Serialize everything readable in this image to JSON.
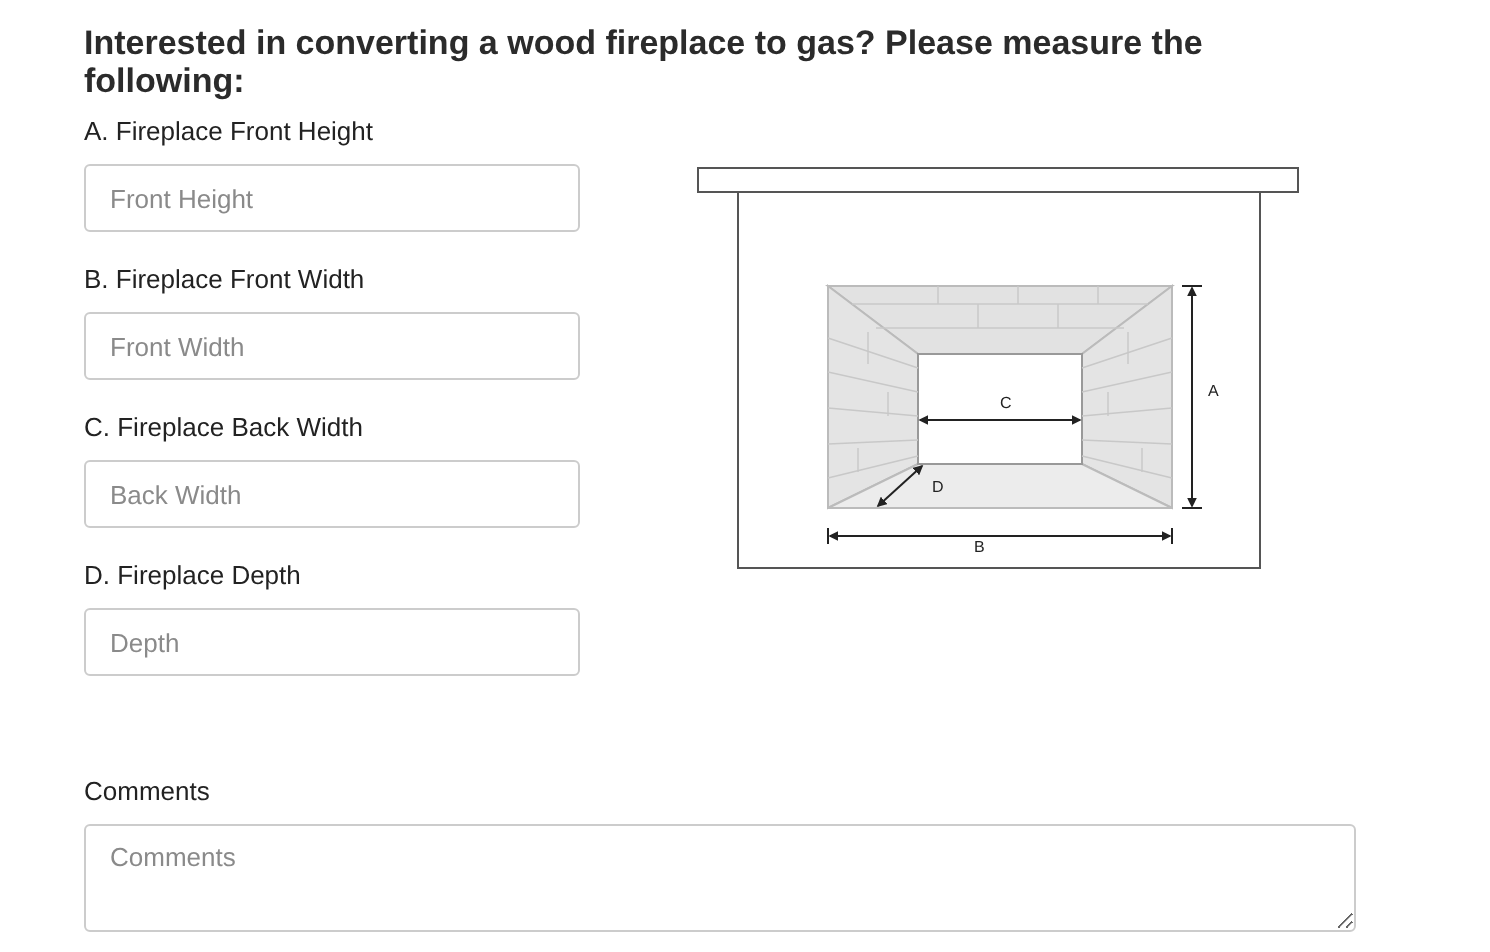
{
  "heading": "Interested in converting a wood fireplace to gas? Please measure the following:",
  "fields": [
    {
      "label": "A. Fireplace Front Height",
      "placeholder": "Front Height"
    },
    {
      "label": "B. Fireplace Front Width",
      "placeholder": "Front Width"
    },
    {
      "label": "C. Fireplace Back Width",
      "placeholder": "Back Width"
    },
    {
      "label": "D. Fireplace Depth",
      "placeholder": "Depth"
    }
  ],
  "diagram": {
    "labels": [
      "C",
      "A",
      "D",
      "B"
    ]
  },
  "comments": {
    "label": "Comments",
    "placeholder": "Comments"
  }
}
